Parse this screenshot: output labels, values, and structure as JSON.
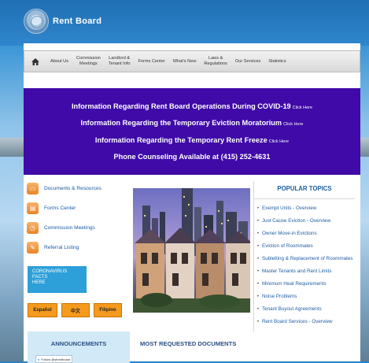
{
  "site": {
    "title": "Rent Board"
  },
  "nav": {
    "items": [
      {
        "label": "About Us"
      },
      {
        "label": "Commission\nMeetings"
      },
      {
        "label": "Landlord &\nTenant Info"
      },
      {
        "label": "Forms Center"
      },
      {
        "label": "What's New"
      },
      {
        "label": "Laws &\nRegulations"
      },
      {
        "label": "Our Services"
      },
      {
        "label": "Statistics"
      }
    ]
  },
  "banner": {
    "lines": [
      {
        "text": "Information Regarding Rent Board Operations During COVID-19",
        "link": "Click Here"
      },
      {
        "text": "Information Regarding the Temporary Eviction Moratorium",
        "link": "Click Here"
      },
      {
        "text": "Information Regarding the Temporary Rent Freeze",
        "link": "Click Here"
      },
      {
        "text": "Phone Counseling Available at (415) 252-4631",
        "link": ""
      }
    ],
    "color": "#3f0aa7"
  },
  "quick_links": [
    {
      "label": "Documents & Resources",
      "icon": "folder-icon"
    },
    {
      "label": "Forms Center",
      "icon": "document-icon"
    },
    {
      "label": "Commission Meetings",
      "icon": "clock-icon"
    },
    {
      "label": "Referral Listing",
      "icon": "pencil-icon"
    }
  ],
  "coronavirus": {
    "text": "CORONAVIRUS\nFACTS\nHERE"
  },
  "languages": [
    {
      "label": "Español"
    },
    {
      "label": "中文"
    },
    {
      "label": "Filipino"
    }
  ],
  "announcements": {
    "title": "ANNOUNCEMENTS",
    "follow": "Follow @sfrentboard"
  },
  "most_requested": {
    "title": "MOST REQUESTED DOCUMENTS"
  },
  "popular": {
    "title": "POPULAR TOPICS",
    "topics": [
      {
        "label": "Exempt Units - Overview"
      },
      {
        "label": "Just Cause Eviction - Overview"
      },
      {
        "label": "Owner Move-in Evictions"
      },
      {
        "label": "Eviction of Roommates"
      },
      {
        "label": "Subletting & Replacement of Roommates"
      },
      {
        "label": "Master Tenants and Rent Limits"
      },
      {
        "label": "Minimum Heat Requirements"
      },
      {
        "label": "Noise Problems"
      },
      {
        "label": "Tenant Buyout Agreements"
      },
      {
        "label": "Rent Board Services - Overview"
      }
    ]
  },
  "colors": {
    "accent": "#1f5fa4",
    "orange": "#f59a1e",
    "header": "#1f6fb4"
  }
}
